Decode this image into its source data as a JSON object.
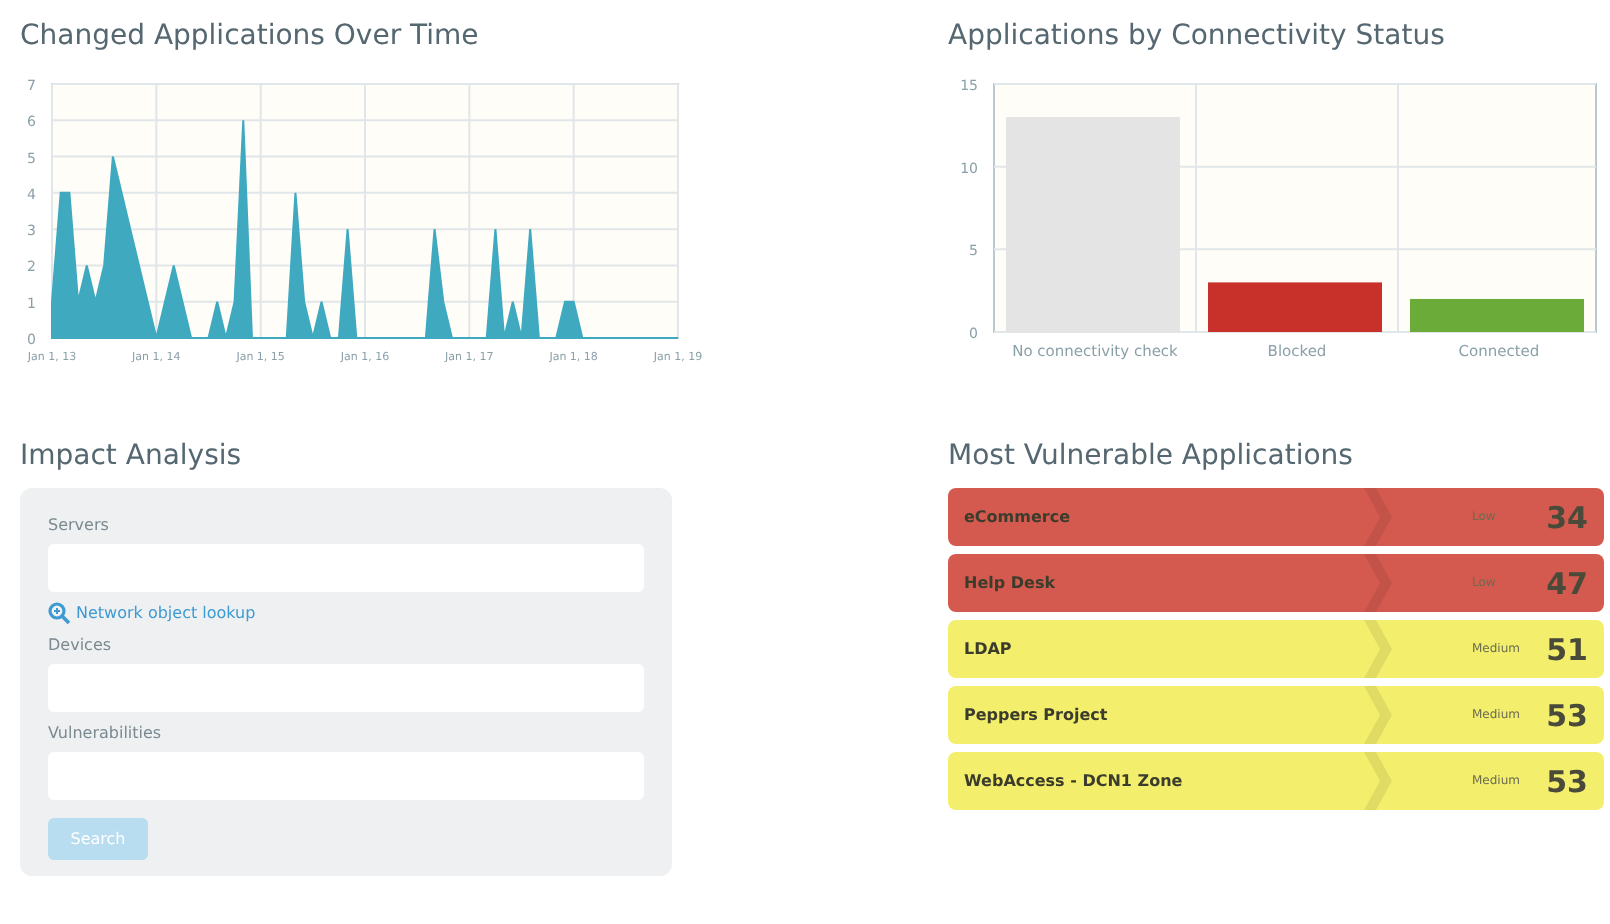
{
  "changed_over_time": {
    "title": "Changed Applications Over Time",
    "chart_data": {
      "type": "area",
      "categories": [
        "Jan 1, 13",
        null,
        null,
        null,
        null,
        null,
        null,
        null,
        null,
        null,
        null,
        null,
        "Jan 1, 14",
        null,
        null,
        null,
        null,
        null,
        null,
        null,
        null,
        null,
        null,
        null,
        "Jan 1, 15",
        null,
        null,
        null,
        null,
        null,
        null,
        null,
        null,
        null,
        null,
        null,
        "Jan 1, 16",
        null,
        null,
        null,
        null,
        null,
        null,
        null,
        null,
        null,
        null,
        null,
        "Jan 1, 17",
        null,
        null,
        null,
        null,
        null,
        null,
        null,
        null,
        null,
        null,
        null,
        "Jan 1, 18",
        null,
        null,
        null,
        null,
        null,
        null,
        null,
        null,
        null,
        null,
        null,
        "Jan 1, 19"
      ],
      "series": [
        {
          "color": "#3fa9c0",
          "values": [
            1,
            4,
            4,
            1,
            2,
            1,
            2,
            5,
            4,
            3,
            2,
            1,
            0,
            1,
            2,
            1,
            0,
            0,
            0,
            1,
            0,
            1,
            6,
            0,
            0,
            0,
            0,
            0,
            4,
            1,
            0,
            1,
            0,
            0,
            3,
            0,
            0,
            0,
            0,
            0,
            0,
            0,
            0,
            0,
            3,
            1,
            0,
            0,
            0,
            0,
            0,
            3,
            0,
            1,
            0,
            3,
            0,
            0,
            0,
            1,
            1,
            0,
            0,
            0,
            0,
            0,
            0,
            0,
            0,
            0,
            0,
            0,
            0
          ]
        }
      ],
      "ylim": [
        0,
        7
      ],
      "yticks": [
        0,
        1,
        2,
        3,
        4,
        5,
        6,
        7
      ],
      "grid": true
    }
  },
  "connectivity": {
    "title": "Applications by Connectivity Status",
    "chart_data": {
      "type": "bar",
      "categories": [
        "No connectivity check",
        "Blocked",
        "Connected"
      ],
      "series": [
        {
          "color": "#e4e4e4",
          "values": [
            13,
            null,
            null
          ]
        },
        {
          "color": "#c8302a",
          "values": [
            null,
            3,
            null
          ]
        },
        {
          "color": "#6aab3a",
          "values": [
            null,
            null,
            2
          ]
        }
      ],
      "ylim": [
        0,
        15
      ],
      "yticks": [
        0,
        5,
        10,
        15
      ],
      "grid": true
    }
  },
  "impact_analysis": {
    "title": "Impact Analysis",
    "fields": [
      {
        "label": "Servers",
        "link": "Network object lookup"
      },
      {
        "label": "Devices"
      },
      {
        "label": "Vulnerabilities"
      }
    ],
    "button": {
      "label": "Search",
      "disabled": true
    }
  },
  "vulnerable_apps": {
    "title": "Most Vulnerable Applications",
    "rows": [
      {
        "name": "eCommerce",
        "severity": "Low",
        "score": "34",
        "color": "#d45a4f"
      },
      {
        "name": "Help Desk",
        "severity": "Low",
        "score": "47",
        "color": "#d45a4f"
      },
      {
        "name": "LDAP",
        "severity": "Medium",
        "score": "51",
        "color": "#f3ef6c"
      },
      {
        "name": "Peppers Project",
        "severity": "Medium",
        "score": "53",
        "color": "#f3ef6c"
      },
      {
        "name": "WebAccess - DCN1 Zone",
        "severity": "Medium",
        "score": "53",
        "color": "#f3ef6c"
      }
    ]
  }
}
